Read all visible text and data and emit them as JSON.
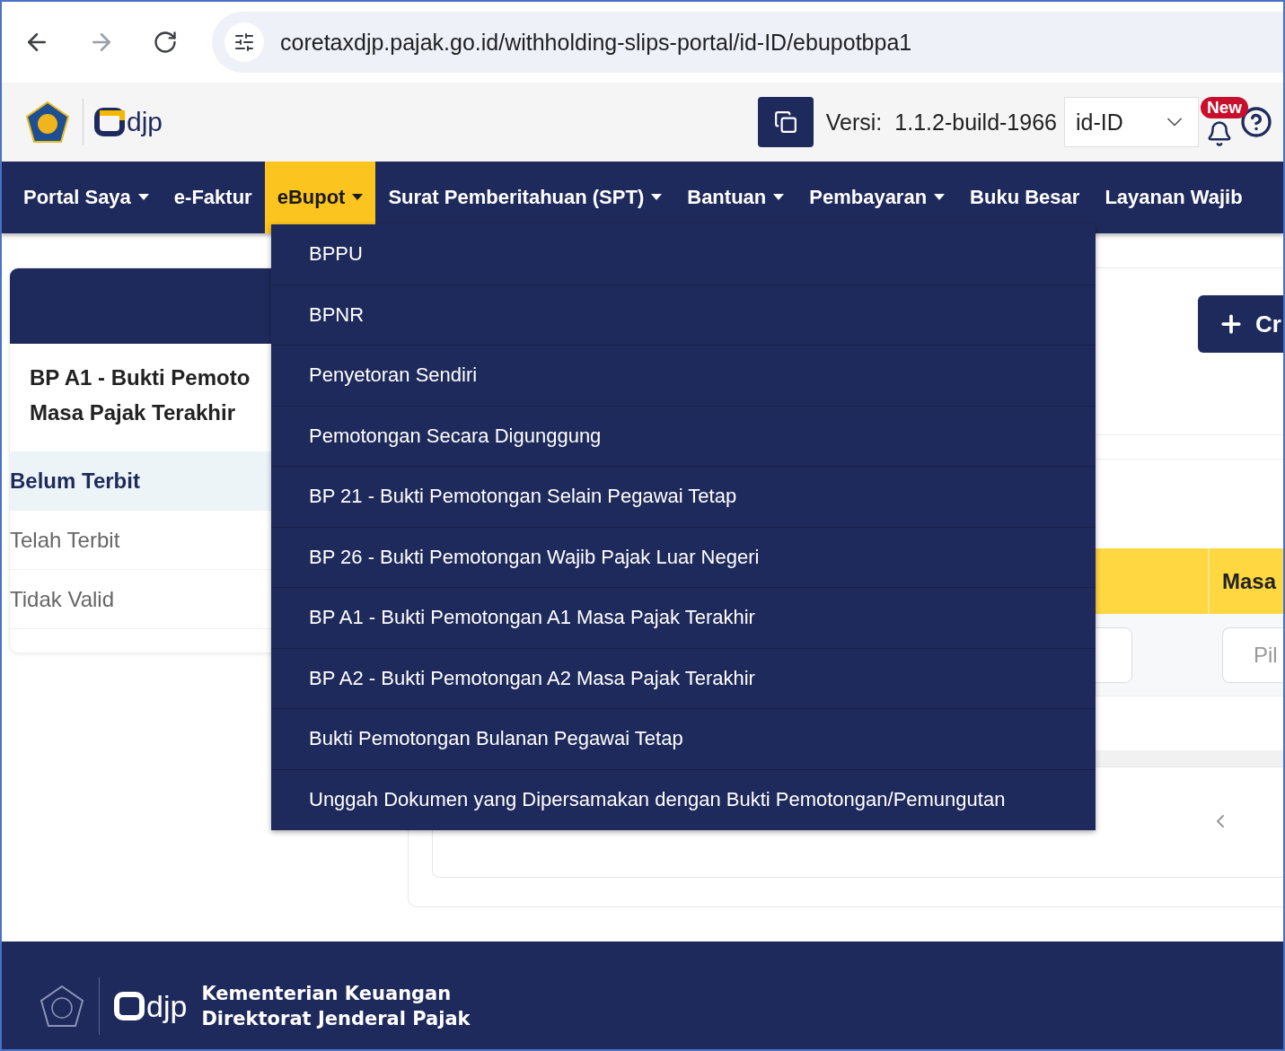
{
  "browser": {
    "url": "coretaxdjp.pajak.go.id/withholding-slips-portal/id-ID/ebupotbpa1"
  },
  "header": {
    "logo_text": "djp",
    "version_label": "Versi:",
    "version": "1.1.2-build-1966",
    "language": "id-ID",
    "badge": "New"
  },
  "nav": [
    {
      "label": "Portal Saya",
      "dropdown": true,
      "selected": false
    },
    {
      "label": "e-Faktur",
      "dropdown": false,
      "selected": false
    },
    {
      "label": "eBupot",
      "dropdown": true,
      "selected": true
    },
    {
      "label": "Surat Pemberitahuan (SPT)",
      "dropdown": true,
      "selected": false
    },
    {
      "label": "Bantuan",
      "dropdown": true,
      "selected": false
    },
    {
      "label": "Pembayaran",
      "dropdown": true,
      "selected": false
    },
    {
      "label": "Buku Besar",
      "dropdown": false,
      "selected": false
    },
    {
      "label": "Layanan Wajib",
      "dropdown": false,
      "selected": false
    }
  ],
  "dropdown_menu": [
    "BPPU",
    "BPNR",
    "Penyetoran Sendiri",
    "Pemotongan Secara Digunggung",
    "BP 21 - Bukti Pemotongan Selain Pegawai Tetap",
    "BP 26 - Bukti Pemotongan Wajib Pajak Luar Negeri",
    "BP A1 - Bukti Pemotongan A1 Masa Pajak Terakhir",
    "BP A2 - Bukti Pemotongan A2 Masa Pajak Terakhir",
    "Bukti Pemotongan Bulanan Pegawai Tetap",
    "Unggah Dokumen yang Dipersamakan dengan Bukti Pemotongan/Pemungutan"
  ],
  "sidebar": {
    "title_lines": [
      "BP A1 - Bukti Pemoto",
      "Masa Pajak Terakhir"
    ],
    "items": [
      {
        "label": "Belum Terbit",
        "selected": true
      },
      {
        "label": "Telah Terbit",
        "selected": false
      },
      {
        "label": "Tidak Valid",
        "selected": false
      }
    ]
  },
  "main": {
    "create_button": "Cr",
    "table": {
      "column_2": "Masa",
      "filter_placeholder": "Pil"
    }
  },
  "footer": {
    "logo_text": "djp",
    "line_1": "Kementerian Keuangan",
    "line_2": "Direktorat Jenderal Pajak"
  }
}
